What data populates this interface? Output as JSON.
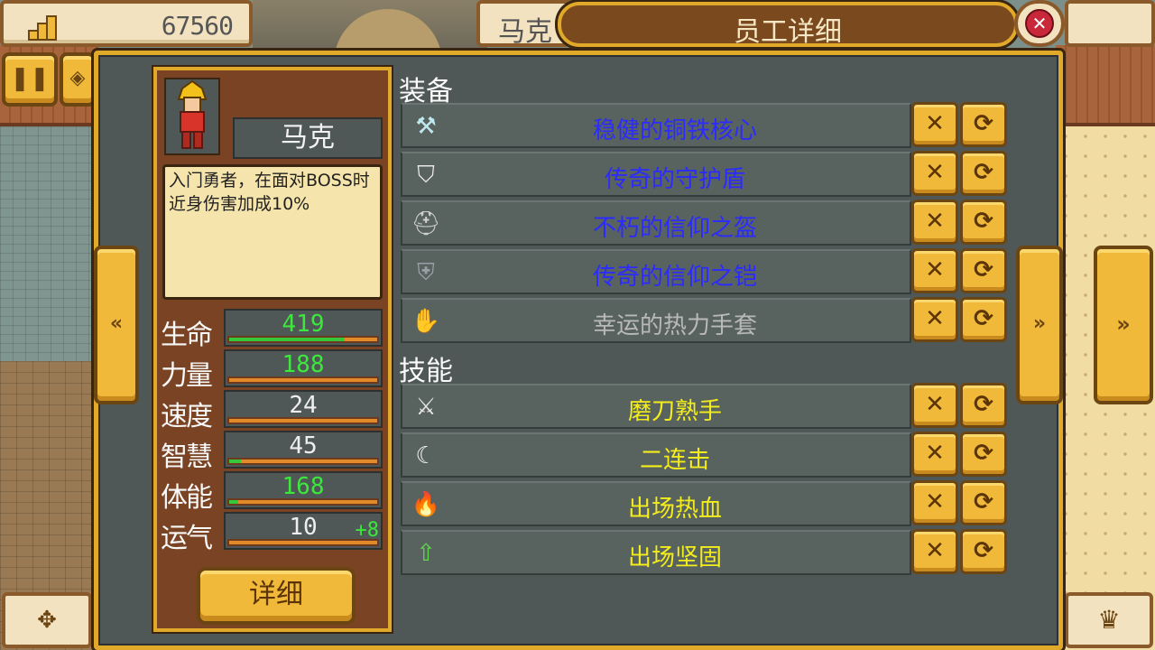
{
  "hud": {
    "gold_amount": "67560",
    "employee_tab_label": "马克",
    "title": "员工详细"
  },
  "character": {
    "name": "马克",
    "description": "入门勇者，在面对BOSS时近身伤害加成10%",
    "stats": [
      {
        "label": "生命",
        "value": "419",
        "value_color": "green",
        "fill": 0.78,
        "bonus": ""
      },
      {
        "label": "力量",
        "value": "188",
        "value_color": "green",
        "fill": 0.0,
        "bonus": ""
      },
      {
        "label": "速度",
        "value": "24",
        "value_color": "white",
        "fill": 0.0,
        "bonus": ""
      },
      {
        "label": "智慧",
        "value": "45",
        "value_color": "white",
        "fill": 0.08,
        "bonus": ""
      },
      {
        "label": "体能",
        "value": "168",
        "value_color": "green",
        "fill": 0.06,
        "bonus": ""
      },
      {
        "label": "运气",
        "value": "10",
        "value_color": "white",
        "fill": 0.0,
        "bonus": "+8"
      }
    ],
    "detail_button_label": "详细"
  },
  "equipment": {
    "title": "装备",
    "items": [
      {
        "name": "稳健的铜铁核心",
        "color": "blue",
        "icon": "axe-icon"
      },
      {
        "name": "传奇的守护盾",
        "color": "blue",
        "icon": "shield-icon"
      },
      {
        "name": "不朽的信仰之盔",
        "color": "blue",
        "icon": "helmet-icon"
      },
      {
        "name": "传奇的信仰之铠",
        "color": "blue",
        "icon": "armor-icon"
      },
      {
        "name": "幸运的热力手套",
        "color": "gray",
        "icon": "glove-icon"
      }
    ]
  },
  "skills": {
    "title": "技能",
    "items": [
      {
        "name": "磨刀熟手",
        "color": "yellow",
        "icon": "sword-icon"
      },
      {
        "name": "二连击",
        "color": "yellow",
        "icon": "slash-icon"
      },
      {
        "name": "出场热血",
        "color": "yellow",
        "icon": "fire-icon"
      },
      {
        "name": "出场坚固",
        "color": "yellow",
        "icon": "shield-up-icon"
      }
    ]
  },
  "colors": {
    "panel_border": "#e0a92a",
    "blue_text": "#2b2bff",
    "yellow_text": "#f3ed1c",
    "green_value": "#3ce83c"
  }
}
